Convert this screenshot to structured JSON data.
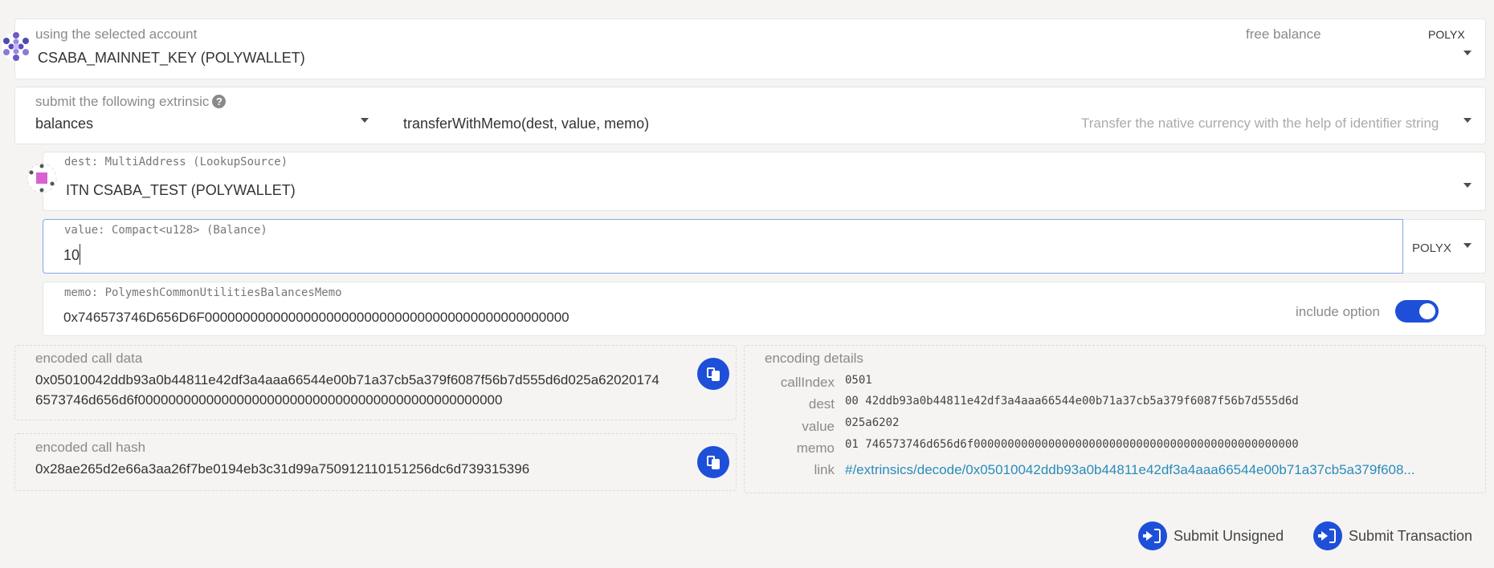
{
  "account": {
    "label": "using the selected account",
    "value": "CSABA_MAINNET_KEY (POLYWALLET)",
    "balance_label": "free balance",
    "balance_unit": "POLYX",
    "icon": "identicon-polkadot"
  },
  "extrinsic": {
    "label": "submit the following extrinsic",
    "help_glyph": "?",
    "module": "balances",
    "method": "transferWithMemo(dest, value, memo)",
    "description": "Transfer the native currency with the help of identifier string"
  },
  "dest": {
    "label": "dest: MultiAddress (LookupSource)",
    "value": "ITN CSABA_TEST (POLYWALLET)"
  },
  "value_field": {
    "label": "value: Compact<u128> (Balance)",
    "value": "10",
    "unit": "POLYX"
  },
  "memo": {
    "label": "memo: PolymeshCommonUtilitiesBalancesMemo",
    "value": "0x746573746D656D6F000000000000000000000000000000000000000000000000",
    "include_label": "include option",
    "include_enabled": true
  },
  "encoded_call_data": {
    "label": "encoded call data",
    "line1": "0x05010042ddb93a0b44811e42df3a4aaa66544e00b71a37cb5a379f6087f56b7d555d6d025a62020174",
    "line2": "6573746d656d6f000000000000000000000000000000000000000000000000"
  },
  "encoded_call_hash": {
    "label": "encoded call hash",
    "value": "0x28ae265d2e66a3aa26f7be0194eb3c31d99a750912110151256dc6d739315396"
  },
  "encoding_details": {
    "title": "encoding details",
    "rows": [
      {
        "key": "callIndex",
        "value": "0501"
      },
      {
        "key": "dest",
        "value": "00 42ddb93a0b44811e42df3a4aaa66544e00b71a37cb5a379f6087f56b7d555d6d"
      },
      {
        "key": "value",
        "value": "025a6202"
      },
      {
        "key": "memo",
        "value": "01 746573746d656d6f000000000000000000000000000000000000000000000000"
      },
      {
        "key": "link",
        "value": "#/extrinsics/decode/0x05010042ddb93a0b44811e42df3a4aaa66544e00b71a37cb5a379f608..."
      }
    ]
  },
  "actions": {
    "submit_unsigned": "Submit Unsigned",
    "submit_transaction": "Submit Transaction"
  },
  "colors": {
    "accent": "#1e4fd8",
    "link": "#2a8cb8",
    "background": "#f5f4f3"
  }
}
